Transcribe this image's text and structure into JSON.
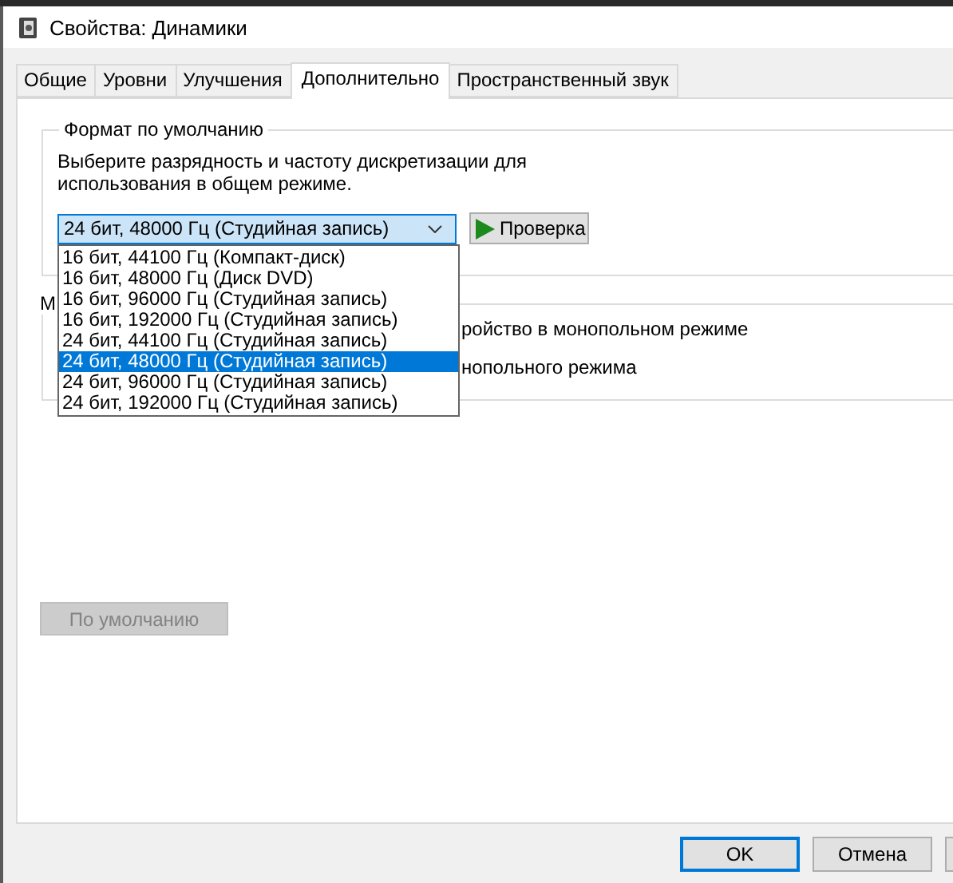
{
  "window": {
    "title": "Свойства: Динамики"
  },
  "tabs": [
    {
      "label": "Общие",
      "selected": false
    },
    {
      "label": "Уровни",
      "selected": false
    },
    {
      "label": "Улучшения",
      "selected": false
    },
    {
      "label": "Дополнительно",
      "selected": true
    },
    {
      "label": "Пространственный звук",
      "selected": false
    }
  ],
  "format_group": {
    "title": "Формат по умолчанию",
    "description": "Выберите разрядность и частоту дискретизации для использования в общем режиме.",
    "combo": {
      "value": "24 бит, 48000 Гц (Студийная запись)",
      "expanded": true,
      "options": [
        {
          "label": "16 бит, 44100 Гц (Компакт-диск)",
          "selected": false
        },
        {
          "label": "16 бит, 48000 Гц (Диск DVD)",
          "selected": false
        },
        {
          "label": "16 бит, 96000 Гц (Студийная запись)",
          "selected": false
        },
        {
          "label": "16 бит, 192000 Гц (Студийная запись)",
          "selected": false
        },
        {
          "label": "24 бит, 44100 Гц (Студийная запись)",
          "selected": false
        },
        {
          "label": "24 бит, 48000 Гц (Студийная запись)",
          "selected": true
        },
        {
          "label": "24 бит, 96000 Гц (Студийная запись)",
          "selected": false
        },
        {
          "label": "24 бит, 192000 Гц (Студийная запись)",
          "selected": false
        }
      ]
    },
    "test_button": "Проверка"
  },
  "exclusive_group": {
    "title": "М",
    "options": [
      "ройство в монопольном режиме",
      "нопольного режима"
    ]
  },
  "default_button": {
    "label": "По умолчанию",
    "disabled": true
  },
  "footer_buttons": [
    {
      "label": "OK",
      "focused": true
    },
    {
      "label": "Отмена",
      "focused": false
    }
  ]
}
